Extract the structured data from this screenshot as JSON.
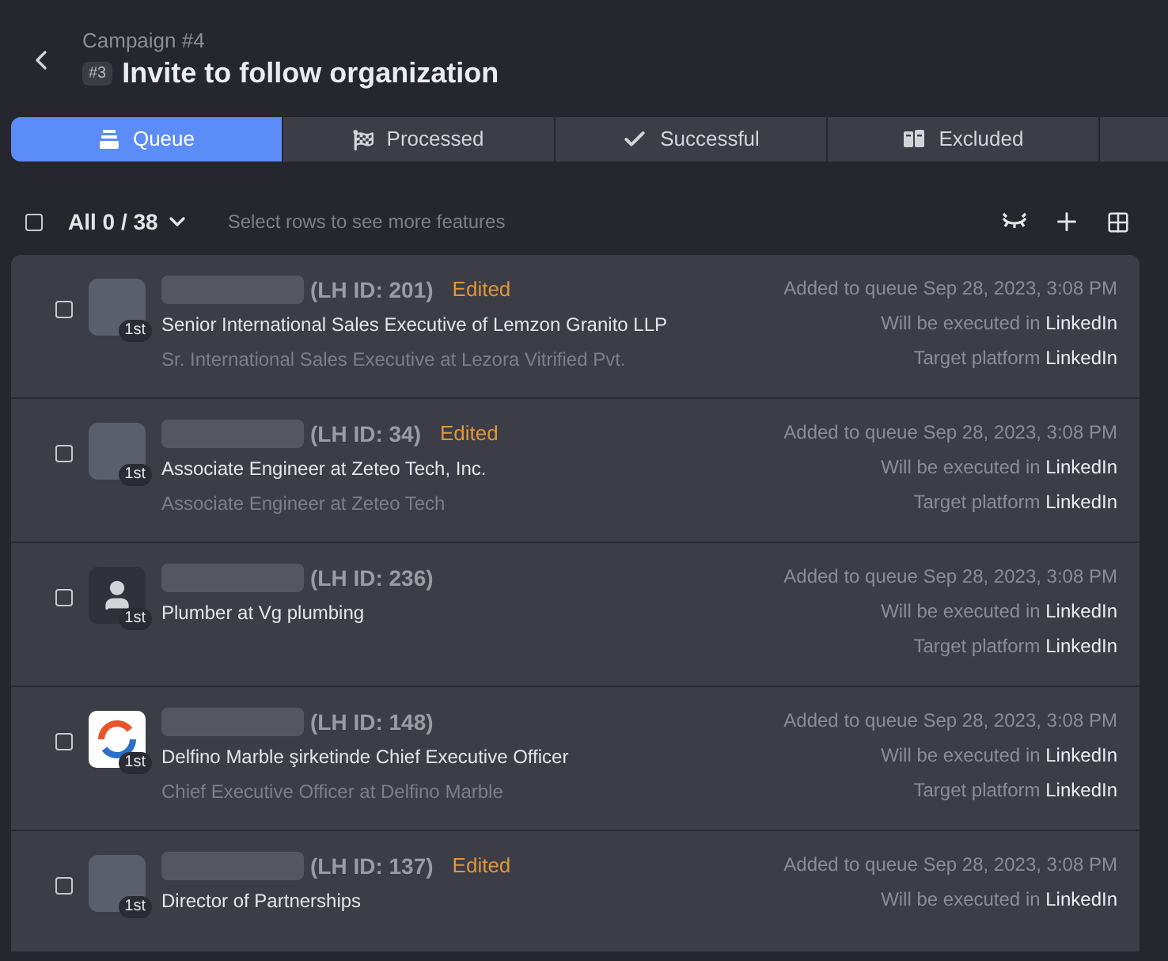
{
  "header": {
    "subtitle": "Campaign #4",
    "badge": "#3",
    "title": "Invite to follow organization"
  },
  "tabs": [
    {
      "label": "Queue",
      "kind": "queue",
      "selected": true
    },
    {
      "label": "Processed",
      "kind": "flag",
      "selected": false
    },
    {
      "label": "Successful",
      "kind": "check",
      "selected": false
    },
    {
      "label": "Excluded",
      "kind": "excluded",
      "selected": false
    },
    {
      "kind": "blank",
      "selected": false
    }
  ],
  "toolbar": {
    "select_all": {
      "checked": false
    },
    "count": "All 0 / 38",
    "hint": "Select rows to see more features"
  },
  "rows": [
    {
      "checked": false,
      "avatar": {
        "kind": "photo",
        "degree": "1st"
      },
      "id": "(LH ID: 201)",
      "edited_label": "Edited",
      "headline": "Senior International Sales Executive of Lemzon Granito LLP",
      "secondary": "Sr. International Sales Executive at Lezora Vitrified Pvt.",
      "added": "Added to queue Sep 28, 2023, 3:08 PM",
      "executed_label": "Will be executed in",
      "executed_platform": "LinkedIn",
      "target_label": "Target platform",
      "target_platform": "LinkedIn"
    },
    {
      "checked": false,
      "avatar": {
        "kind": "photo",
        "degree": "1st"
      },
      "id": "(LH ID: 34)",
      "edited_label": "Edited",
      "headline": "Associate Engineer at Zeteo Tech, Inc.",
      "secondary": "Associate Engineer at Zeteo Tech",
      "added": "Added to queue Sep 28, 2023, 3:08 PM",
      "executed_label": "Will be executed in",
      "executed_platform": "LinkedIn",
      "target_label": "Target platform",
      "target_platform": "LinkedIn"
    },
    {
      "checked": false,
      "avatar": {
        "kind": "person",
        "degree": "1st"
      },
      "id": "(LH ID: 236)",
      "headline": "Plumber at Vg plumbing",
      "added": "Added to queue Sep 28, 2023, 3:08 PM",
      "executed_label": "Will be executed in",
      "executed_platform": "LinkedIn",
      "target_label": "Target platform",
      "target_platform": "LinkedIn"
    },
    {
      "checked": false,
      "avatar": {
        "kind": "logo",
        "degree": "1st"
      },
      "id": "(LH ID: 148)",
      "headline": "Delfino Marble şirketinde Chief Executive Officer",
      "secondary": "Chief Executive Officer at Delfino Marble",
      "added": "Added to queue Sep 28, 2023, 3:08 PM",
      "executed_label": "Will be executed in",
      "executed_platform": "LinkedIn",
      "target_label": "Target platform",
      "target_platform": "LinkedIn"
    },
    {
      "checked": false,
      "avatar": {
        "kind": "photo",
        "degree": "1st"
      },
      "id": "(LH ID: 137)",
      "edited_label": "Edited",
      "headline": "Director of Partnerships",
      "added": "Added to queue Sep 28, 2023, 3:08 PM",
      "executed_label": "Will be executed in",
      "executed_platform": "LinkedIn"
    }
  ]
}
